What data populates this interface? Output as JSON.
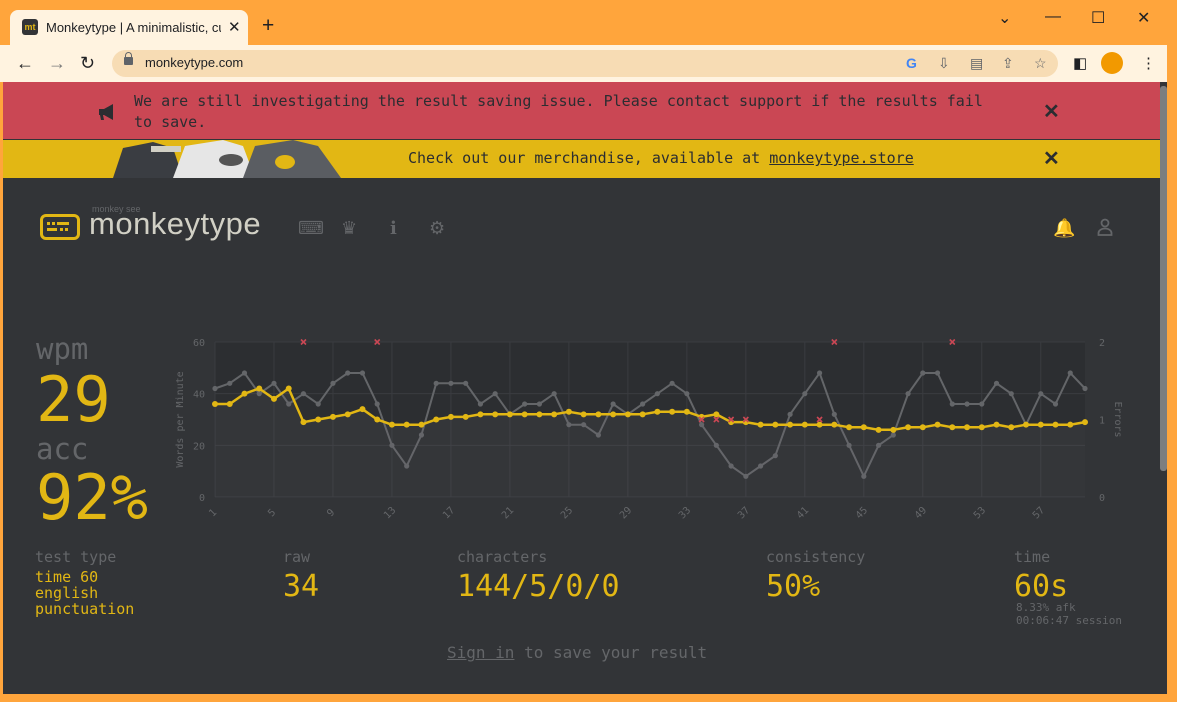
{
  "browser": {
    "tab_title": "Monkeytype | A minimalistic, customizable typing test",
    "favicon_text": "mt",
    "url": "monkeytype.com"
  },
  "notices": {
    "red": "We are still investigating the result saving issue. Please contact support if the results fail to save.",
    "yellow_prefix": "Check out our merchandise, available at ",
    "yellow_link": "monkeytype.store"
  },
  "logo": {
    "sub": "monkey see",
    "name": "monkeytype"
  },
  "result": {
    "wpm_label": "wpm",
    "wpm": "29",
    "acc_label": "acc",
    "acc": "92%",
    "test_type_label": "test type",
    "test_type": [
      "time 60",
      "english",
      "punctuation"
    ],
    "raw_label": "raw",
    "raw": "34",
    "characters_label": "characters",
    "characters": "144/5/0/0",
    "consistency_label": "consistency",
    "consistency": "50%",
    "time_label": "time",
    "time": "60s",
    "afk": "8.33% afk",
    "session": "00:06:47 session"
  },
  "signin": {
    "link": "Sign in",
    "rest": " to save your result"
  },
  "colors": {
    "bg": "#323437",
    "main": "#e2b714",
    "sub": "#646669",
    "text": "#d1d0c5",
    "error": "#ca4754"
  },
  "chart_data": {
    "type": "line",
    "ylabel": "Words per Minute",
    "y2label": "Errors",
    "ylim": [
      0,
      60
    ],
    "y2lim": [
      0,
      2
    ],
    "yticks": [
      0,
      20,
      40,
      60
    ],
    "y2ticks": [
      0,
      1,
      2
    ],
    "xticks": [
      1,
      5,
      9,
      13,
      17,
      21,
      25,
      29,
      33,
      37,
      41,
      45,
      49,
      53,
      57
    ],
    "x": [
      1,
      2,
      3,
      4,
      5,
      6,
      7,
      8,
      9,
      10,
      11,
      12,
      13,
      14,
      15,
      16,
      17,
      18,
      19,
      20,
      21,
      22,
      23,
      24,
      25,
      26,
      27,
      28,
      29,
      30,
      31,
      32,
      33,
      34,
      35,
      36,
      37,
      38,
      39,
      40,
      41,
      42,
      43,
      44,
      45,
      46,
      47,
      48,
      49,
      50,
      51,
      52,
      53,
      54,
      55,
      56,
      57,
      58,
      59,
      60
    ],
    "series": [
      {
        "values": [
          42,
          44,
          48,
          40,
          44,
          36,
          40,
          36,
          44,
          48,
          48,
          36,
          20,
          12,
          24,
          44,
          44,
          44,
          36,
          40,
          32,
          36,
          36,
          40,
          28,
          28,
          24,
          36,
          32,
          36,
          40,
          44,
          40,
          28,
          20,
          12,
          8,
          12,
          16,
          32,
          40,
          48,
          32,
          20,
          8,
          20,
          24,
          40,
          48,
          48,
          36,
          36,
          36,
          44,
          40,
          28,
          40,
          36,
          48,
          42
        ]
      },
      {
        "values": [
          36,
          36,
          40,
          42,
          38,
          42,
          29,
          30,
          31,
          32,
          34,
          30,
          28,
          28,
          28,
          30,
          31,
          31,
          32,
          32,
          32,
          32,
          32,
          32,
          33,
          32,
          32,
          32,
          32,
          32,
          33,
          33,
          33,
          31,
          32,
          29,
          29,
          28,
          28,
          28,
          28,
          28,
          28,
          27,
          27,
          26,
          26,
          27,
          27,
          28,
          27,
          27,
          27,
          28,
          27,
          28,
          28,
          28,
          28,
          29
        ]
      }
    ],
    "errors": [
      {
        "x": 7,
        "y": 2
      },
      {
        "x": 12,
        "y": 2
      },
      {
        "x": 34,
        "y": 1
      },
      {
        "x": 35,
        "y": 1
      },
      {
        "x": 36,
        "y": 1
      },
      {
        "x": 37,
        "y": 1
      },
      {
        "x": 42,
        "y": 1
      },
      {
        "x": 43,
        "y": 2
      },
      {
        "x": 51,
        "y": 2
      }
    ]
  }
}
